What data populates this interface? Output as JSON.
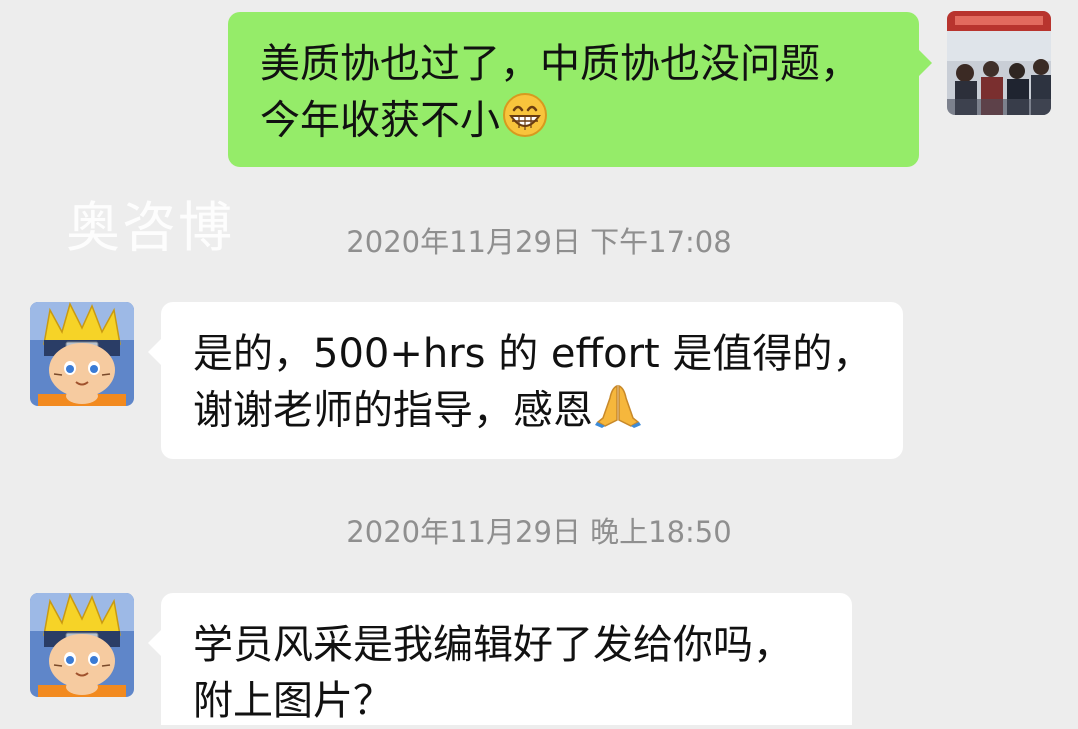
{
  "watermark": "奥咨博",
  "timestamps": [
    "2020年11月29日 下午17:08",
    "2020年11月29日 晚上18:50"
  ],
  "messages": [
    {
      "direction": "outgoing",
      "lines": [
        "美质协也过了，中质协也没问题，",
        "今年收获不小"
      ],
      "emoji": "grinning-face"
    },
    {
      "direction": "incoming",
      "lines": [
        "是的，500+hrs 的 effort 是值得的，",
        "谢谢老师的指导，感恩"
      ],
      "emoji": "folded-hands"
    },
    {
      "direction": "incoming",
      "lines": [
        "学员风采是我编辑好了发给你吗，",
        "附上图片？"
      ]
    }
  ],
  "colors": {
    "background": "#ededed",
    "outgoing_bubble": "#95ec69",
    "incoming_bubble": "#ffffff",
    "timestamp_text": "#8f8f8f"
  }
}
